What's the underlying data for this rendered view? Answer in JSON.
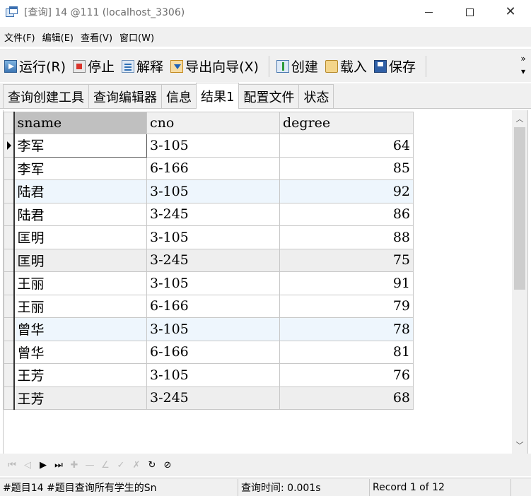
{
  "window": {
    "title": "[查询] 14 @111 (localhost_3306)"
  },
  "menu": [
    {
      "label": "文件(F)"
    },
    {
      "label": "编辑(E)"
    },
    {
      "label": "查看(V)"
    },
    {
      "label": "窗口(W)"
    }
  ],
  "toolbar": {
    "run": "运行(R)",
    "stop": "停止",
    "explain": "解释",
    "export": "导出向导(X)",
    "create": "创建",
    "load": "载入",
    "save": "保存",
    "more": "»"
  },
  "tabs": [
    {
      "label": "查询创建工具"
    },
    {
      "label": "查询编辑器"
    },
    {
      "label": "信息"
    },
    {
      "label": "结果1"
    },
    {
      "label": "配置文件"
    },
    {
      "label": "状态"
    }
  ],
  "grid": {
    "columns": [
      "sname",
      "cno",
      "degree"
    ],
    "rows": [
      [
        "李军",
        "3-105",
        "64"
      ],
      [
        "李军",
        "6-166",
        "85"
      ],
      [
        "陆君",
        "3-105",
        "92"
      ],
      [
        "陆君",
        "3-245",
        "86"
      ],
      [
        "匡明",
        "3-105",
        "88"
      ],
      [
        "匡明",
        "3-245",
        "75"
      ],
      [
        "王丽",
        "3-105",
        "91"
      ],
      [
        "王丽",
        "6-166",
        "79"
      ],
      [
        "曾华",
        "3-105",
        "78"
      ],
      [
        "曾华",
        "6-166",
        "81"
      ],
      [
        "王芳",
        "3-105",
        "76"
      ],
      [
        "王芳",
        "3-245",
        "68"
      ]
    ]
  },
  "status": {
    "query": "#题目14 #题目查询所有学生的Sn",
    "time": "查询时间: 0.001s",
    "record": "Record 1 of 12"
  }
}
